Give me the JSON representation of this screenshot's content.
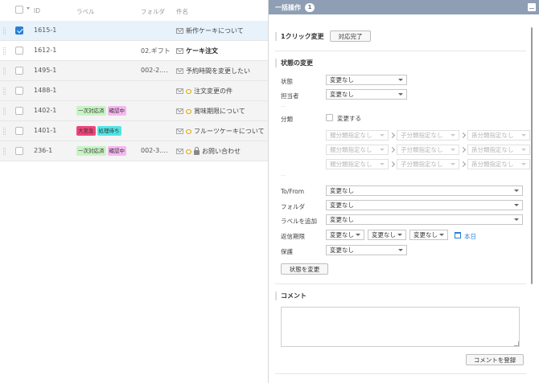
{
  "list": {
    "headers": {
      "id": "ID",
      "label": "ラベル",
      "folder": "フォルダ",
      "subject": "件名"
    },
    "rows": [
      {
        "id": "1615-1",
        "folder": "",
        "subject": "新作ケーキについて",
        "selected": true,
        "unread": true,
        "tags": []
      },
      {
        "id": "1612-1",
        "folder": "02.ギフト",
        "subject": "ケーキ注文",
        "selected": false,
        "unread": true,
        "tags": []
      },
      {
        "id": "1495-1",
        "folder": "002-2.…",
        "subject": "予約時間を変更したい",
        "selected": false,
        "unread": false,
        "tags": []
      },
      {
        "id": "1488-1",
        "folder": "",
        "subject": "注文変更の件",
        "selected": false,
        "unread": false,
        "tags": []
      },
      {
        "id": "1402-1",
        "folder": "",
        "subject": "賞味期限について",
        "selected": false,
        "unread": false,
        "tags": [
          {
            "text": "一次対応済",
            "color": "#c9f3c4"
          },
          {
            "text": "確認中",
            "color": "#f5b8ef"
          }
        ]
      },
      {
        "id": "1401-1",
        "folder": "",
        "subject": "フルーツケーキについて",
        "selected": false,
        "unread": false,
        "tags": [
          {
            "text": "大至急",
            "color": "#f0447a"
          },
          {
            "text": "処理待ち",
            "color": "#50e6e6"
          }
        ]
      },
      {
        "id": "236-1",
        "folder": "002-3.…",
        "subject": "お問い合わせ",
        "selected": false,
        "unread": false,
        "tags": [
          {
            "text": "一次対応済",
            "color": "#c9f3c4"
          },
          {
            "text": "確認中",
            "color": "#f5b8ef"
          }
        ]
      }
    ]
  },
  "panel": {
    "title": "一括操作",
    "count": "1",
    "one_click": {
      "label": "1クリック変更",
      "button": "対応完了"
    },
    "status_change": {
      "heading": "状態の変更",
      "state": {
        "label": "状態",
        "value": "変更なし"
      },
      "assignee": {
        "label": "担当者",
        "value": "変更なし"
      },
      "category": {
        "label": "分類",
        "checkbox": "変更する"
      },
      "sub_placeholders": [
        "親分類指定なし",
        "子分類指定なし",
        "孫分類指定なし"
      ],
      "to_from": {
        "label": "To/From",
        "value": "変更なし"
      },
      "folder": {
        "label": "フォルダ",
        "value": "変更なし"
      },
      "add_label": {
        "label": "ラベルを追加",
        "value": "変更なし"
      },
      "reply_due": {
        "label": "返信期限",
        "values": [
          "変更なし",
          "変更なし",
          "変更なし"
        ],
        "today": "本日"
      },
      "hold": {
        "label": "保護",
        "value": "変更なし"
      },
      "apply_button": "状態を変更"
    },
    "comment": {
      "heading": "コメント",
      "placeholder": "",
      "button": "コメントを登録"
    }
  },
  "colors": {
    "header": "#8e9fb5",
    "accent": "#2a7fd4",
    "selected_row": "#e7f2fb"
  }
}
